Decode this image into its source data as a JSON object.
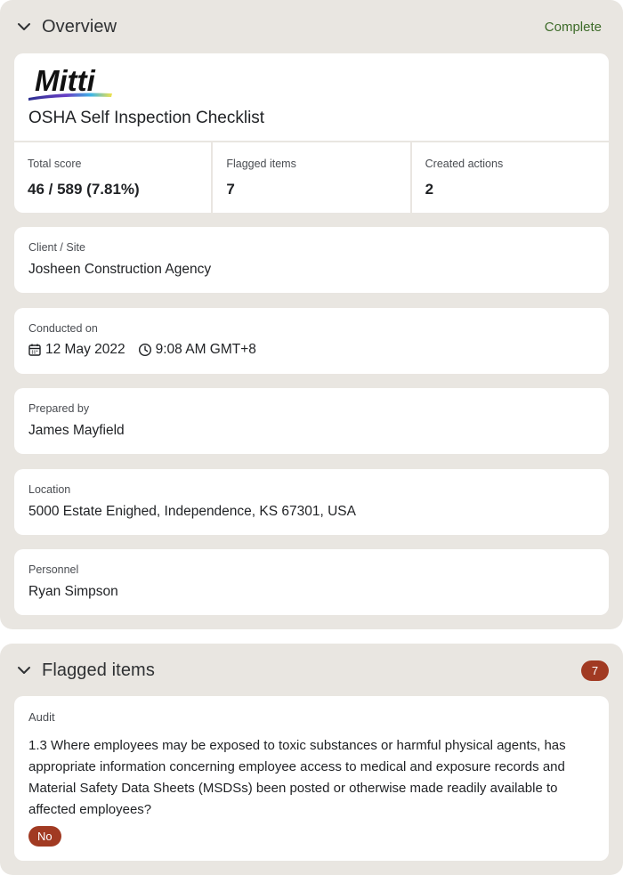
{
  "overview": {
    "title": "Overview",
    "status": "Complete",
    "logo_text": "Mitti",
    "report_title": "OSHA Self Inspection Checklist",
    "stats": [
      {
        "label": "Total score",
        "value": "46 / 589 (7.81%)"
      },
      {
        "label": "Flagged items",
        "value": "7"
      },
      {
        "label": "Created actions",
        "value": "2"
      }
    ],
    "client": {
      "label": "Client / Site",
      "value": "Josheen Construction Agency"
    },
    "conducted": {
      "label": "Conducted on",
      "date": "12 May 2022",
      "time": "9:08 AM GMT+8"
    },
    "prepared": {
      "label": "Prepared by",
      "value": "James Mayfield"
    },
    "location": {
      "label": "Location",
      "value": "5000 Estate Enighed, Independence, KS 67301, USA"
    },
    "personnel": {
      "label": "Personnel",
      "value": "Ryan Simpson"
    }
  },
  "flagged": {
    "title": "Flagged items",
    "count": "7",
    "items": [
      {
        "section": "Audit",
        "question": "1.3 Where employees may be exposed to toxic substances or harmful physical agents, has appropriate information concerning employee access to medical and exposure records and Material Safety Data Sheets (MSDSs) been posted or otherwise made readily available to affected employees?",
        "answer": "No"
      }
    ]
  },
  "colors": {
    "section_bg": "#e9e6e1",
    "card_bg": "#ffffff",
    "status_green": "#3d6b29",
    "flag_red": "#a13a22"
  },
  "icons": [
    "chevron-down-icon",
    "calendar-icon",
    "clock-icon"
  ]
}
